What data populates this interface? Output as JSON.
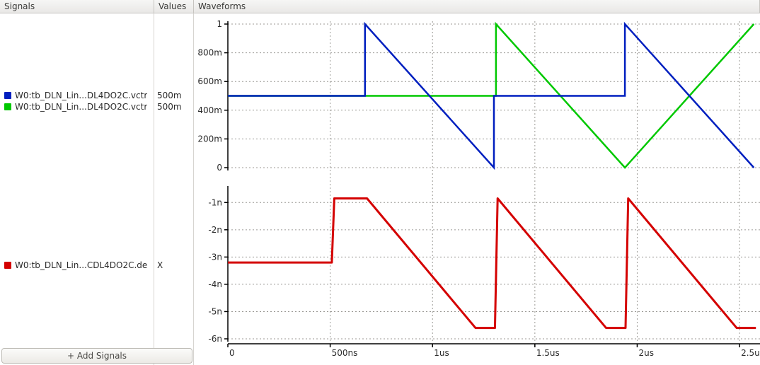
{
  "header": {
    "signals": "Signals",
    "values": "Values",
    "waveforms": "Waveforms"
  },
  "add_button": "+ Add Signals",
  "signals": [
    {
      "color": "#001fbf",
      "label": "W0:tb_DLN_Lin...DL4DO2C.vctr",
      "value": "500m"
    },
    {
      "color": "#00c800",
      "label": "W0:tb_DLN_Lin...DL4DO2C.vctr",
      "value": "500m"
    },
    {
      "color": "#d40000",
      "label": "W0:tb_DLN_Lin...CDL4DO2C.de",
      "value": "X"
    }
  ],
  "chart_data": [
    {
      "type": "line",
      "title": "",
      "xlabel": "time",
      "x_unit": "s",
      "x_range_ns": [
        0,
        2600
      ],
      "x_ticks_ns": [
        0,
        500,
        1000,
        1500,
        2000,
        2500
      ],
      "x_tick_labels": [
        "0",
        "500ns",
        "1us",
        "1.5us",
        "2us",
        "2.5us"
      ],
      "ylabel": "",
      "y_range": [
        0,
        1
      ],
      "y_ticks": [
        0,
        0.2,
        0.4,
        0.6,
        0.8,
        1
      ],
      "y_tick_labels": [
        "0",
        "200m",
        "400m",
        "600m",
        "800m",
        "1"
      ],
      "series": [
        {
          "name": "W0:tb_DLN_Lin...DL4DO2C.vctr (blue)",
          "color": "#001fbf",
          "points": [
            [
              0,
              0.5
            ],
            [
              670,
              0.5
            ],
            [
              670,
              1.0
            ],
            [
              1300,
              0.0
            ],
            [
              1300,
              0.5
            ],
            [
              1940,
              0.5
            ],
            [
              1940,
              1.0
            ],
            [
              2570,
              0.0
            ]
          ]
        },
        {
          "name": "W0:tb_DLN_Lin...DL4DO2C.vctr (green)",
          "color": "#00c800",
          "points": [
            [
              0,
              0.5
            ],
            [
              1310,
              0.5
            ],
            [
              1310,
              1.0
            ],
            [
              1940,
              0.0
            ],
            [
              2570,
              1.0
            ]
          ]
        }
      ]
    },
    {
      "type": "line",
      "title": "",
      "xlabel": "time",
      "x_unit": "s",
      "x_range_ns": [
        0,
        2600
      ],
      "ylabel": "",
      "y_range": [
        -6e-09,
        -5e-10
      ],
      "y_ticks": [
        -1e-09,
        -2e-09,
        -3e-09,
        -4e-09,
        -5e-09,
        -6e-09
      ],
      "y_tick_labels": [
        "-1n",
        "-2n",
        "-3n",
        "-4n",
        "-5n",
        "-6n"
      ],
      "series": [
        {
          "name": "W0:tb_DLN_Lin...CDL4DO2C.de (red)",
          "color": "#d40000",
          "points": [
            [
              0,
              -3.2e-09
            ],
            [
              508,
              -3.2e-09
            ],
            [
              520,
              -8.5e-10
            ],
            [
              680,
              -8.5e-10
            ],
            [
              1210,
              -5.6e-09
            ],
            [
              1305,
              -5.6e-09
            ],
            [
              1318,
              -8.5e-10
            ],
            [
              1848,
              -5.6e-09
            ],
            [
              1943,
              -5.6e-09
            ],
            [
              1956,
              -8.5e-10
            ],
            [
              2486,
              -5.6e-09
            ],
            [
              2580,
              -5.6e-09
            ]
          ]
        }
      ]
    }
  ]
}
